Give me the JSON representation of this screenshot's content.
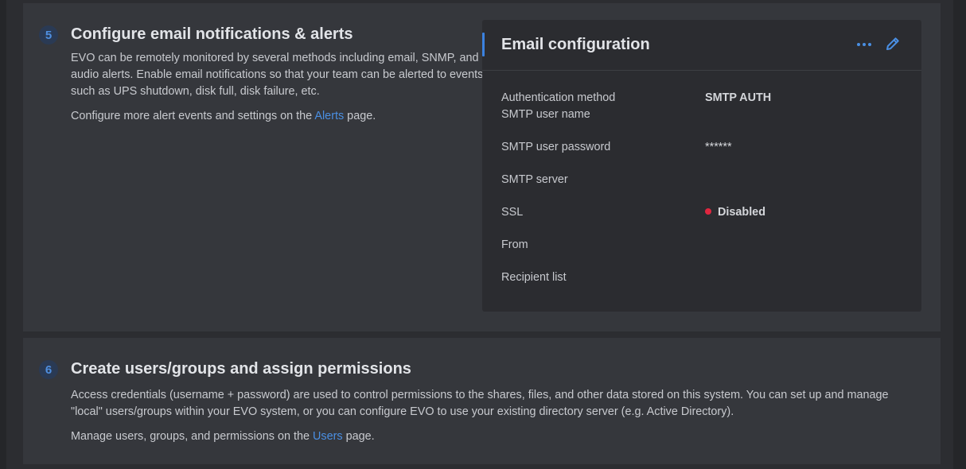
{
  "step5": {
    "number": "5",
    "title": "Configure email notifications & alerts",
    "description": "EVO can be remotely monitored by several methods including email, SNMP, and audio alerts. Enable email notifications so that your team can be alerted to events such as UPS shutdown, disk full, disk failure, etc.",
    "more_prefix": "Configure more alert events and settings on the ",
    "more_link": "Alerts",
    "more_suffix": " page."
  },
  "email_panel": {
    "title": "Email configuration",
    "more_icon": "more-dots-icon",
    "edit_icon": "pencil-icon",
    "accent_color": "#3b82e0",
    "fields": [
      {
        "label": "Authentication method",
        "value": "SMTP AUTH"
      },
      {
        "label": "SMTP user name",
        "value": ""
      },
      {
        "label": "SMTP user password",
        "value": "******"
      },
      {
        "label": "SMTP server",
        "value": ""
      },
      {
        "label": "SSL",
        "value": "Disabled",
        "status_color": "#e0263f"
      },
      {
        "label": "From",
        "value": ""
      },
      {
        "label": "Recipient list",
        "value": ""
      }
    ]
  },
  "step6": {
    "number": "6",
    "title": "Create users/groups and assign permissions",
    "description": "Access credentials (username + password) are used to control permissions to the shares, files, and other data stored on this system. You can set up and manage \"local\" users/groups within your EVO system, or you can configure EVO to use your existing directory server (e.g. Active Directory).",
    "more_prefix": "Manage users, groups, and permissions on the ",
    "more_link": "Users",
    "more_suffix": " page."
  }
}
